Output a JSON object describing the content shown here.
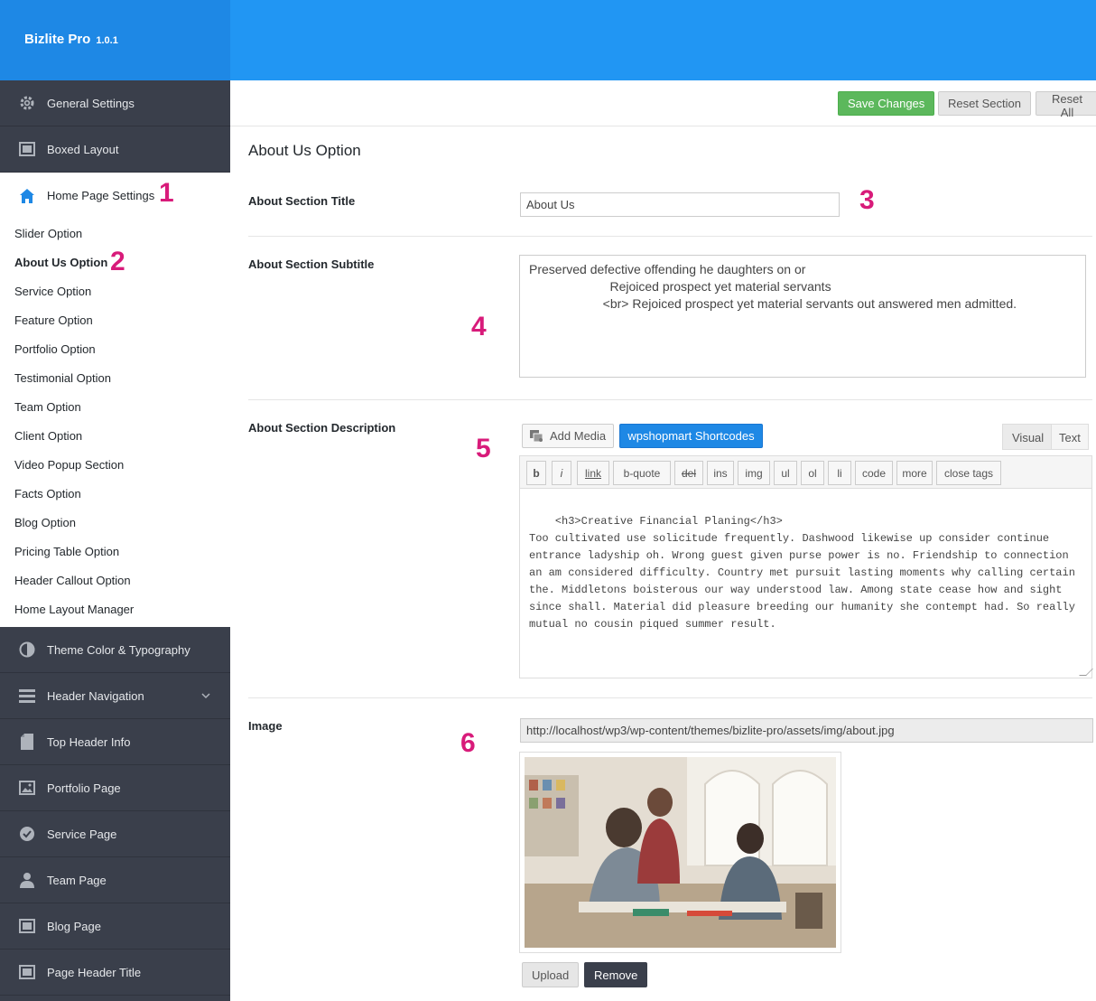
{
  "app": {
    "name": "Bizlite Pro",
    "version": "1.0.1"
  },
  "sidebar": {
    "items_top": [
      {
        "label": "General Settings",
        "icon": "gear-icon"
      },
      {
        "label": "Boxed Layout",
        "icon": "window-icon"
      },
      {
        "label": "Home Page Settings",
        "icon": "home-icon"
      }
    ],
    "sub_items": [
      "Slider Option",
      "About Us Option",
      "Service Option",
      "Feature Option",
      "Portfolio Option",
      "Testimonial Option",
      "Team Option",
      "Client Option",
      "Video Popup Section",
      "Facts Option",
      "Blog Option",
      "Pricing Table Option",
      "Header Callout Option",
      "Home Layout Manager"
    ],
    "items_bottom": [
      {
        "label": "Theme Color & Typography",
        "icon": "contrast-icon"
      },
      {
        "label": "Header Navigation",
        "icon": "menu-icon"
      },
      {
        "label": "Top Header Info",
        "icon": "document-icon"
      },
      {
        "label": "Portfolio Page",
        "icon": "image-icon"
      },
      {
        "label": "Service Page",
        "icon": "check-circle-icon"
      },
      {
        "label": "Team Page",
        "icon": "user-icon"
      },
      {
        "label": "Blog Page",
        "icon": "window-icon"
      },
      {
        "label": "Page Header Title",
        "icon": "window-icon"
      }
    ]
  },
  "actions": {
    "save": "Save Changes",
    "reset_section": "Reset Section",
    "reset_all": "Reset All"
  },
  "section": {
    "title": "About Us Option",
    "fields": {
      "title_label": "About Section Title",
      "title_value": "About Us",
      "subtitle_label": "About Section Subtitle",
      "subtitle_value": "Preserved defective offending he daughters on or\n                       Rejoiced prospect yet material servants\n                     <br> Rejoiced prospect yet material servants out answered men admitted.",
      "description_label": "About Section Description",
      "description_value": "<h3>Creative Financial Planing</h3>\nToo cultivated use solicitude frequently. Dashwood likewise up consider continue entrance ladyship oh. Wrong guest given purse power is no. Friendship to connection an am considered difficulty. Country met pursuit lasting moments why calling certain the. Middletons boisterous our way understood law. Among state cease how and sight since shall. Material did pleasure breeding our humanity she contempt had. So really mutual no cousin piqued summer result.",
      "image_label": "Image",
      "image_url": "http://localhost/wp3/wp-content/themes/bizlite-pro/assets/img/about.jpg"
    }
  },
  "editor": {
    "add_media": "Add Media",
    "shortcodes": "wpshopmart Shortcodes",
    "tab_visual": "Visual",
    "tab_text": "Text",
    "quicktags": [
      "b",
      "i",
      "link",
      "b-quote",
      "del",
      "ins",
      "img",
      "ul",
      "ol",
      "li",
      "code",
      "more",
      "close tags"
    ]
  },
  "image_buttons": {
    "upload": "Upload",
    "remove": "Remove"
  },
  "markers": [
    "1",
    "2",
    "3",
    "4",
    "5",
    "6"
  ],
  "colors": {
    "header": "#2196f3",
    "sidebar": "#3a3f4b",
    "accent": "#1e88e5",
    "save": "#5cb85c",
    "marker": "#d81b7a"
  }
}
